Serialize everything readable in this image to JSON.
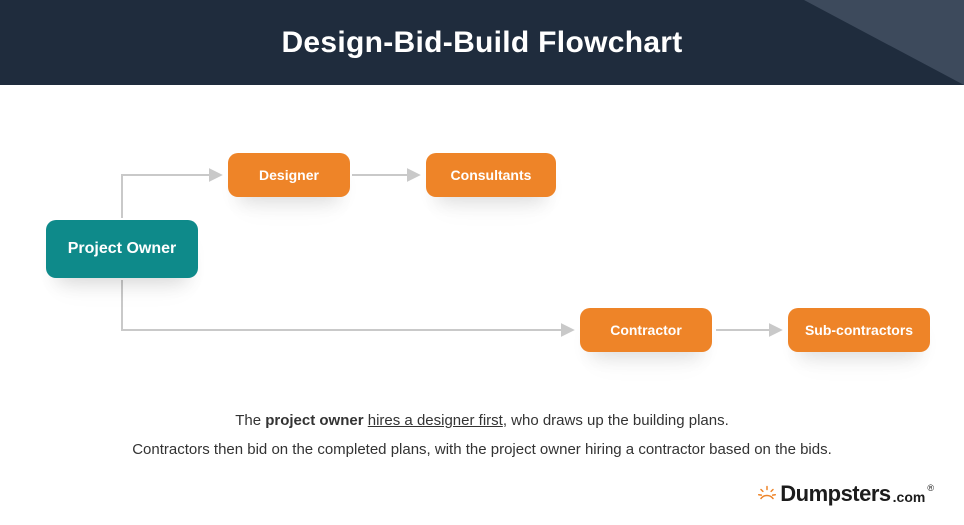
{
  "header": {
    "title": "Design-Bid-Build Flowchart"
  },
  "nodes": {
    "owner": "Project Owner",
    "designer": "Designer",
    "consultants": "Consultants",
    "contractor": "Contractor",
    "subcontractors": "Sub-contractors"
  },
  "caption": {
    "line1_pre": "The ",
    "line1_bold": "project owner",
    "line1_space": " ",
    "line1_underline": "hires a designer first",
    "line1_post": ", who draws up the building plans.",
    "line2": "Contractors then bid on the completed plans, with the project owner hiring a contractor based on the bids."
  },
  "logo": {
    "brand": "Dumpsters",
    "tld": ".com",
    "reg": "®"
  },
  "colors": {
    "teal": "#0e8a8a",
    "orange": "#ee8428",
    "headerBg": "#1f2c3d",
    "arrow": "#c9c9c9"
  },
  "flows": [
    {
      "from": "owner",
      "to": "designer"
    },
    {
      "from": "designer",
      "to": "consultants"
    },
    {
      "from": "owner",
      "to": "contractor"
    },
    {
      "from": "contractor",
      "to": "subcontractors"
    }
  ]
}
